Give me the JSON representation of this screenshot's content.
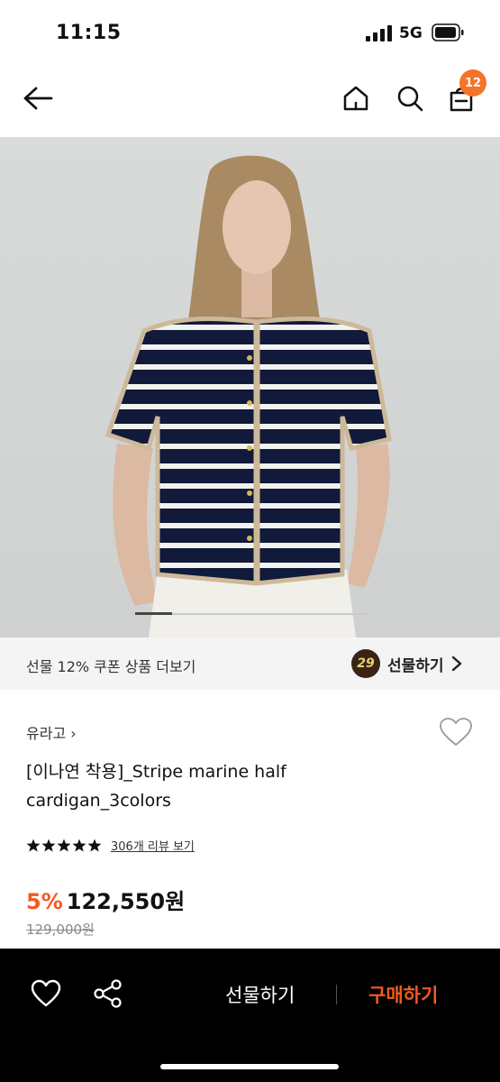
{
  "status": {
    "time": "11:15",
    "network": "5G"
  },
  "nav": {
    "cart_count": "12"
  },
  "gift_bar": {
    "promo_text": "선물 12% 쿠폰 상품 더보기",
    "coin_count": "29",
    "gift_label": "선물하기"
  },
  "product": {
    "brand": "유라고 ›",
    "title": "[이나연 착용]_Stripe marine half cardigan_3colors",
    "rating_stars": 5,
    "review_link": "306개 리뷰 보기",
    "discount": "5%",
    "price": "122,550원",
    "original_price": "129,000원"
  },
  "image_gallery": {
    "current_fraction": 0.16
  },
  "bottom_bar": {
    "gift_label": "선물하기",
    "buy_label": "구매하기"
  },
  "colors": {
    "accent": "#f25a1e",
    "badge": "#f5742a",
    "bottom_bg": "#000000"
  }
}
